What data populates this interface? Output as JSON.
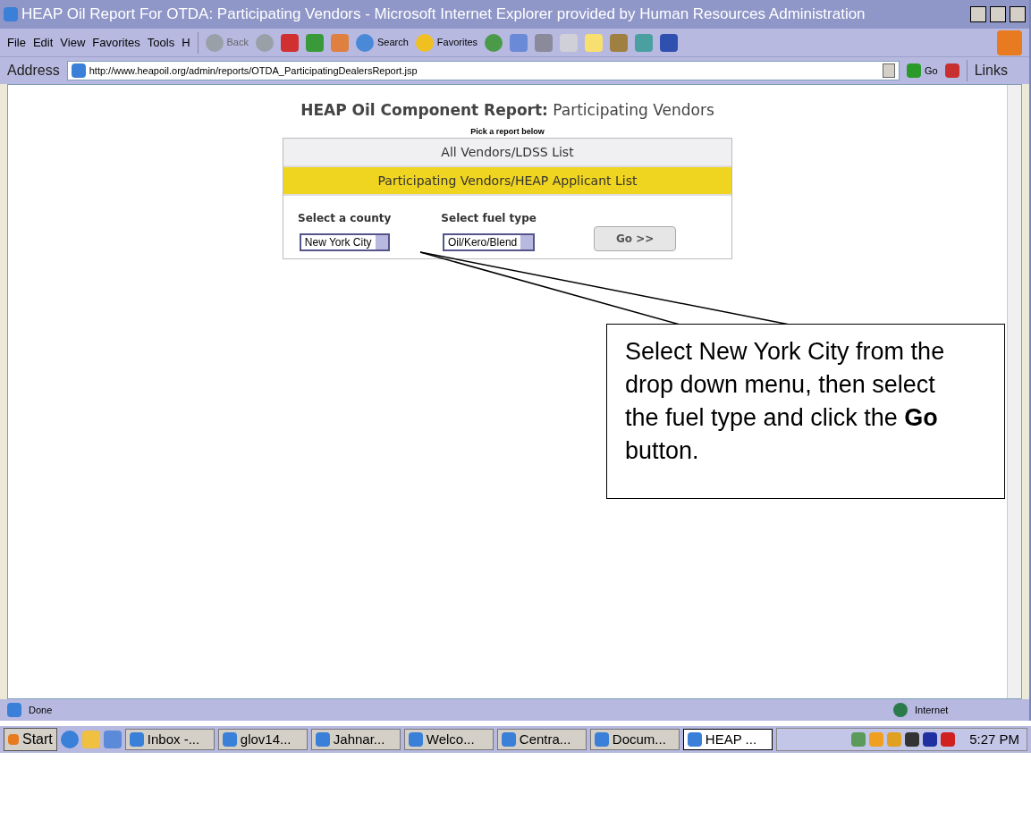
{
  "window": {
    "title": "HEAP Oil Report For OTDA: Participating Vendors - Microsoft Internet Explorer provided by Human Resources Administration"
  },
  "menu": [
    "File",
    "Edit",
    "View",
    "Favorites",
    "Tools",
    "H"
  ],
  "toolbar": {
    "back": "Back",
    "search": "Search",
    "favorites": "Favorites"
  },
  "address_bar": {
    "label": "Address",
    "url": "http://www.heapoil.org/admin/reports/OTDA_ParticipatingDealersReport.jsp",
    "go": "Go",
    "links": "Links"
  },
  "page": {
    "heading": "**HEAP Oil Component Report:** Participating Vendors",
    "subheading": "Pick a report below",
    "reports": [
      {
        "label": "All Vendors/LDSS List",
        "selected": false
      },
      {
        "label": "Participating Vendors/HEAP Applicant List",
        "selected": true
      }
    ],
    "county": {
      "label": "Select a county",
      "value": "New York City"
    },
    "fuel": {
      "label": "Select fuel type",
      "value": "Oil/Kero/Blend"
    },
    "go_button": "Go >>"
  },
  "callout": "Select New York City from the drop down menu, then select the fuel type and click the **Go** button.",
  "status_bar": {
    "status": "Done",
    "zone": "Internet"
  },
  "taskbar": {
    "start": "Start",
    "tasks": [
      {
        "label": "Inbox -...",
        "selected": false
      },
      {
        "label": "glov14...",
        "selected": false
      },
      {
        "label": "Jahnar...",
        "selected": false
      },
      {
        "label": "Welco...",
        "selected": false
      },
      {
        "label": "Centra...",
        "selected": false
      },
      {
        "label": "Docum...",
        "selected": false
      },
      {
        "label": "HEAP ...",
        "selected": true
      }
    ],
    "clock": "5:27 PM"
  }
}
